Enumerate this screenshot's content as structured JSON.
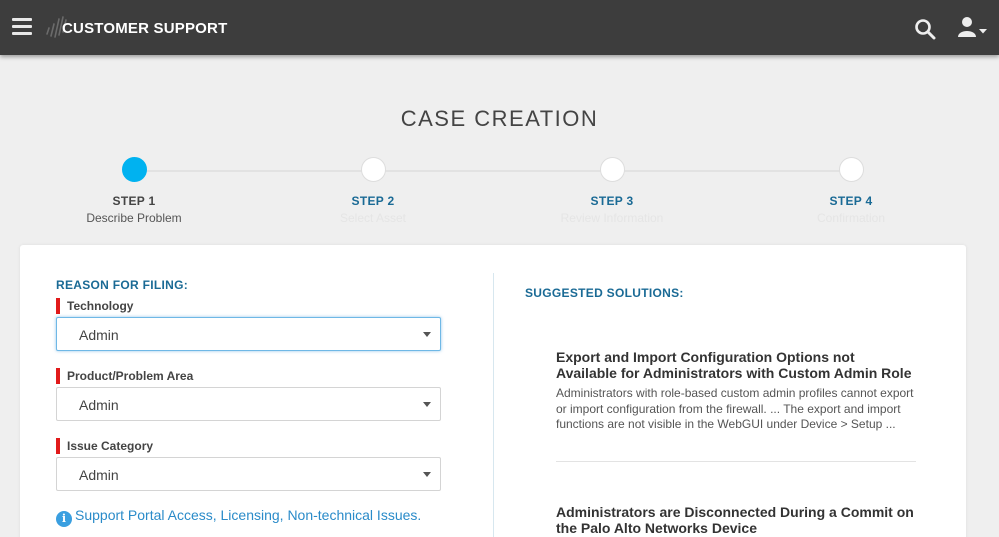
{
  "header": {
    "brand": "CUSTOMER SUPPORT",
    "menu_icon": "hamburger-menu-icon",
    "search_icon": "search-icon",
    "user_icon": "user-dropdown-icon",
    "bg_color": "#3d3d3d"
  },
  "page": {
    "title": "CASE CREATION"
  },
  "steps": [
    {
      "label": "STEP 1",
      "sub": "Describe Problem",
      "active": true
    },
    {
      "label": "STEP 2",
      "sub": "Select Asset",
      "active": false
    },
    {
      "label": "STEP 3",
      "sub": "Review Information",
      "active": false
    },
    {
      "label": "STEP 4",
      "sub": "Confirmation",
      "active": false
    }
  ],
  "form": {
    "section_title": "REASON FOR FILING:",
    "fields": [
      {
        "label": "Technology",
        "value": "Admin"
      },
      {
        "label": "Product/Problem Area",
        "value": "Admin"
      },
      {
        "label": "Issue Category",
        "value": "Admin"
      }
    ],
    "info_link": "Support Portal Access, Licensing, Non-technical Issues."
  },
  "suggestions": {
    "title": "SUGGESTED SOLUTIONS:",
    "items": [
      {
        "title": "Export and Import Configuration Options not Available for Administrators with Custom Admin Role",
        "body": "Administrators with role-based custom admin profiles cannot export or import configuration from the firewall. ... The export and import functions are not visible in the WebGUI under Device > Setup ..."
      },
      {
        "title": "Administrators are Disconnected During a Commit on the Palo Alto Networks Device",
        "body": ""
      }
    ]
  },
  "colors": {
    "accent": "#00b2f0",
    "heading_blue": "#1a6a95",
    "link_blue": "#2a8bc9",
    "required_red": "#e11a1a"
  }
}
